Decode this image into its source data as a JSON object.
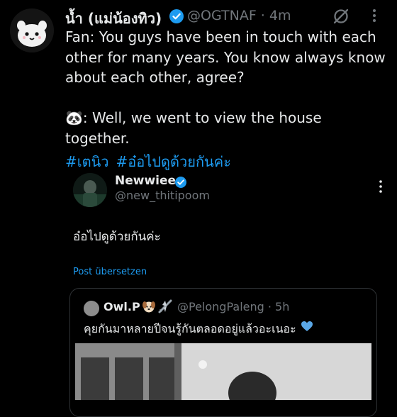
{
  "author": {
    "name": "น้ำ (แม่น้องทิว)",
    "handle": "@OGTNAF",
    "time": "· 4m"
  },
  "tweet": {
    "text": "Fan: You guys have been in touch with each other for many years. You know always know about each other, agree?\n\n🐼: Well, we went to view the house together.",
    "hashtags": [
      "#เตนิว",
      "#อ๋อไปดูด้วยกันค่ะ"
    ]
  },
  "embedded": {
    "name": "Newwiee",
    "handle": "@new_thitipoom",
    "text": "อ๋อไปดูด้วยกันค่ะ",
    "translate_label": "Post übersetzen"
  },
  "quote": {
    "name": "Owl.P",
    "handle": "@PelongPaleng · 5h",
    "text": "คุยกันมาหลายปีจนรู้กันตลอดอยู่แล้วอะเนอะ"
  },
  "colors": {
    "background": "#000000",
    "text": "#e7e9ea",
    "secondary": "#71767b",
    "accent": "#1d9bf0"
  },
  "icons": [
    "verified-badge-icon",
    "grok-icon",
    "more-icon",
    "heart-emoji-icon"
  ]
}
